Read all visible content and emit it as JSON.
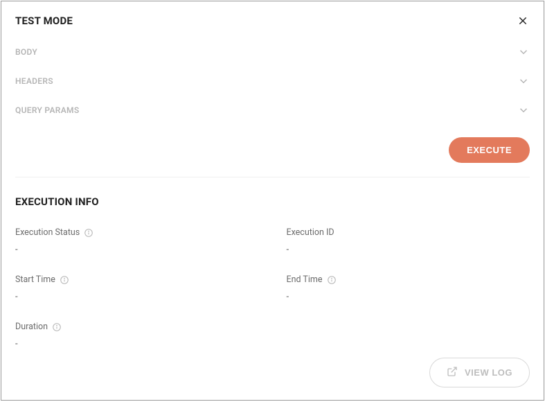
{
  "header": {
    "title": "TEST MODE"
  },
  "accordions": {
    "body": "BODY",
    "headers": "HEADERS",
    "queryParams": "QUERY PARAMS"
  },
  "buttons": {
    "execute": "EXECUTE",
    "viewLog": "VIEW LOG"
  },
  "execInfo": {
    "title": "EXECUTION INFO",
    "fields": {
      "executionStatus": {
        "label": "Execution Status",
        "value": "-"
      },
      "executionId": {
        "label": "Execution ID",
        "value": "-"
      },
      "startTime": {
        "label": "Start Time",
        "value": "-"
      },
      "endTime": {
        "label": "End Time",
        "value": "-"
      },
      "duration": {
        "label": "Duration",
        "value": "-"
      }
    }
  }
}
